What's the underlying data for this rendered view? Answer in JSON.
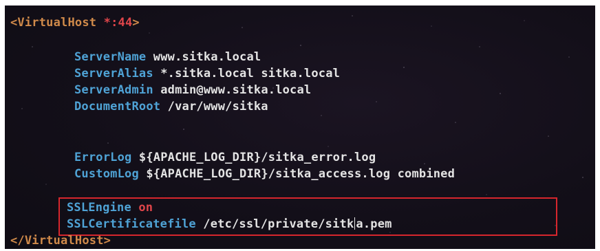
{
  "vhost": {
    "open_tag": "<VirtualHost ",
    "open_addr": "*:44",
    "open_close": ">",
    "close_tag": "</VirtualHost>"
  },
  "directives": [
    {
      "key": "ServerName",
      "value": " www.sitka.local"
    },
    {
      "key": "ServerAlias",
      "value": " *.sitka.local sitka.local"
    },
    {
      "key": "ServerAdmin",
      "value": " admin@www.sitka.local"
    },
    {
      "key": "DocumentRoot",
      "value": " /var/www/sitka"
    },
    {
      "key": "ErrorLog",
      "value": " ${APACHE_LOG_DIR}/sitka_error.log"
    },
    {
      "key": "CustomLog",
      "value": " ${APACHE_LOG_DIR}/sitka_access.log combined"
    }
  ],
  "ssl": {
    "engine_key": "SSLEngine",
    "engine_value": " on",
    "cert_key": "SSLCertificatefile",
    "cert_value_before_cursor": " /etc/ssl/private/sitk",
    "cert_value_after_cursor": "a.pem"
  },
  "colors": {
    "tag": "#d08a4a",
    "directive": "#4fa3d6",
    "value": "#e4e4e4",
    "accent_red": "#e0454a",
    "highlight_box": "#d7262d",
    "background": "#130f19"
  }
}
